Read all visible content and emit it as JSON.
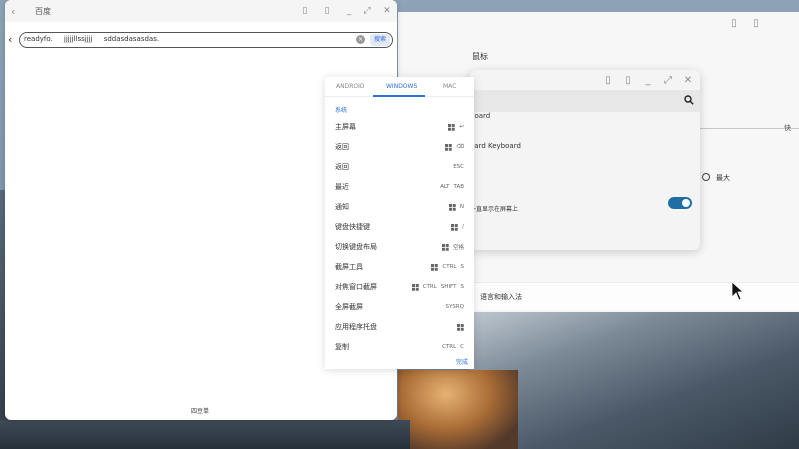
{
  "browser": {
    "title": "百度",
    "url_text": "readyfo.     jjjjjllssjjjj     sddasdasasdas.",
    "search_button": "搜索",
    "footer": "四豆单"
  },
  "settings": {
    "mouse_label": "鼠标",
    "right_label": "快",
    "large_label": "最大",
    "language_label": "语言和输入法"
  },
  "keyboard_window": {
    "item1": "board",
    "item2": "oard Keyboard",
    "toggle_label": "一直显示在屏幕上",
    "toggle_on": true
  },
  "shortcut_panel": {
    "tabs": [
      {
        "label": "ANDROID",
        "active": false
      },
      {
        "label": "WINDOWS",
        "active": true
      },
      {
        "label": "MAC",
        "active": false
      }
    ],
    "section": "系统",
    "rows": [
      {
        "label": "主屏幕",
        "win": true,
        "keys": [
          "↩"
        ]
      },
      {
        "label": "返回",
        "win": true,
        "keys": [
          "⌫"
        ]
      },
      {
        "label": "返回",
        "win": false,
        "keys": [
          "ESC"
        ]
      },
      {
        "label": "最近",
        "win": false,
        "keys": [
          "ALT",
          "TAB"
        ]
      },
      {
        "label": "通知",
        "win": true,
        "keys": [
          "N"
        ]
      },
      {
        "label": "键盘快捷键",
        "win": true,
        "keys": [
          "/"
        ]
      },
      {
        "label": "切换键盘布局",
        "win": true,
        "keys": [
          "空格"
        ]
      },
      {
        "label": "截屏工具",
        "win": true,
        "keys": [
          "CTRL",
          "S"
        ]
      },
      {
        "label": "对焦窗口截屏",
        "win": true,
        "keys": [
          "CTRL",
          "SHIFT",
          "S"
        ]
      },
      {
        "label": "全屏截屏",
        "win": false,
        "keys": [
          "SYSRQ"
        ]
      },
      {
        "label": "应用程序托盘",
        "win": true,
        "keys": []
      },
      {
        "label": "复制",
        "win": false,
        "keys": [
          "CTRL",
          "C"
        ]
      }
    ],
    "done": "完成"
  },
  "icons": {
    "back": "chevron-left-icon",
    "search": "search-icon",
    "windows": "windows-logo-icon",
    "clear": "clear-icon",
    "cursor": "mouse-cursor-icon"
  },
  "colors": {
    "accent": "#2b6fd6",
    "toggle": "#1f6fa5"
  }
}
